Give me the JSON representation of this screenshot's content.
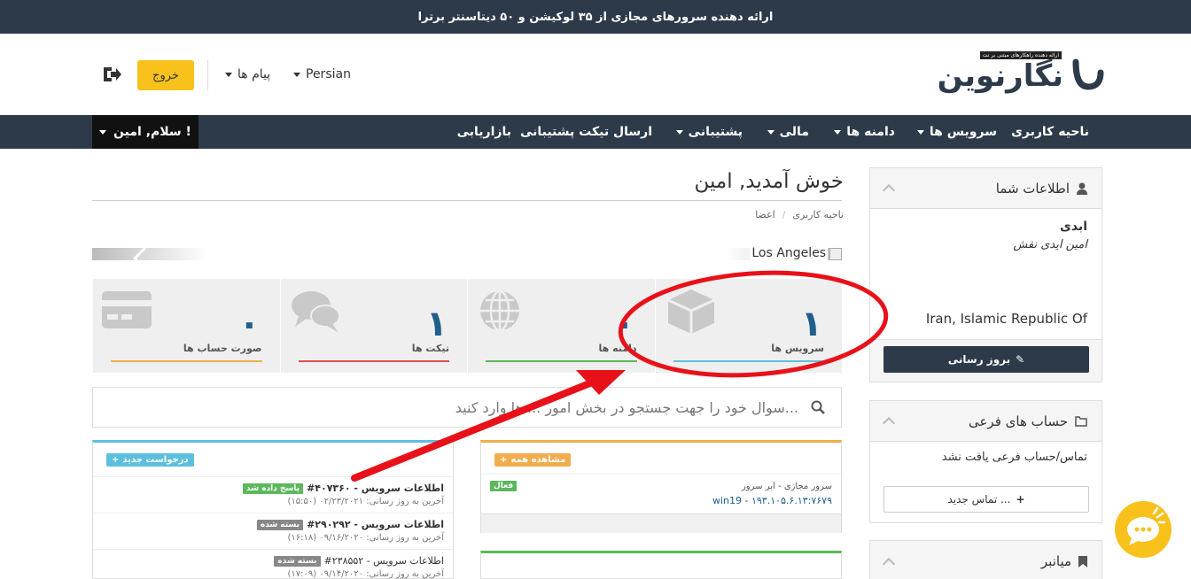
{
  "topbar": {
    "text": "ارائه دهنده سرورهای مجازی از ۳۵ لوکیشن و ۵۰ دیتاسنتر برترا"
  },
  "header": {
    "logo_name": "نگارنوین",
    "logo_tagline": "ارائه دهنده راهکارهای مبتنی بر نت",
    "language": "Persian",
    "messages": "پیام ها",
    "logout": "خروج"
  },
  "nav": {
    "items": [
      "ناحیه کاربری",
      "سرویس ها",
      "دامنه ها",
      "مالی",
      "پشتیبانی",
      "ارسال تیکت پشتیبانی",
      "بازاریابی"
    ],
    "hello": "سلام, امین !"
  },
  "user_panel": {
    "title": "اطلاعات شما",
    "line1": "ابدی",
    "line2": "امین ایدی نقش",
    "country": "Iran, Islamic Republic Of",
    "update": "بروز رسانی"
  },
  "subaccounts": {
    "title": "حساب های فرعی",
    "empty": "تماس/حساب فرعی یافت نشد",
    "new_contact": "تماس جدید ..."
  },
  "shortcuts": {
    "title": "میانبر"
  },
  "main": {
    "title": "خوش آمدید, امین",
    "breadcrumb": [
      "اعضا",
      "/",
      "ناحیه کاربری"
    ],
    "slider_label": "Los Angeles",
    "search_placeholder": "سوال خود را جهت جستجو در بخش امور ... ها وارد کنید..."
  },
  "stats": [
    {
      "num": "۱",
      "label": "سرویس ها",
      "color": "#5bc0de",
      "icon": "cube-icon"
    },
    {
      "num": "۰",
      "label": "دامنه ها",
      "color": "#5cb85c",
      "icon": "globe-icon"
    },
    {
      "num": "۱",
      "label": "تیکت ها",
      "color": "#d9534f",
      "icon": "comments-icon"
    },
    {
      "num": "۰",
      "label": "صورت حساب ها",
      "color": "#f0ad4e",
      "icon": "credit-card-icon"
    }
  ],
  "services_panel": {
    "view_all": "مشاهده همه",
    "item_line1": "سرور مجازی - ابر سرور",
    "item_line2": "win19 - ۱۹۳.۱۰۵.۶.۱۳:۷۶۷۹",
    "status": "فعال"
  },
  "tickets_panel": {
    "new_request": "درخواست جدید",
    "tickets": [
      {
        "id": "#۴۰۷۳۶۰ - اطلاعات سرویس",
        "status": "پاسخ داده شد",
        "status_color": "#5cb85c",
        "updated": "آخرین به روز رسانی: ۰۲/۲۳/۲۰۲۱ (۱۵:۵۰)"
      },
      {
        "id": "#۲۹۰۲۹۲ - اطلاعات سرویس",
        "status": "بسته شده",
        "status_color": "#888888",
        "updated": "آخرین به روز رسانی: ۰۹/۱۶/۲۰۲۰ (۱۶:۱۸)"
      },
      {
        "id": "#۲۳۸۵۵۲ - اطلاعات سرویس",
        "status": "بسته شده",
        "status_color": "#888888",
        "updated": "آخرین به روز رسانی: ۰۹/۱۴/۲۰۲۰ (۱۷:۰۹)"
      }
    ]
  },
  "annotation": {
    "circle_color": "#e8111a",
    "arrow_color": "#e8111a"
  }
}
